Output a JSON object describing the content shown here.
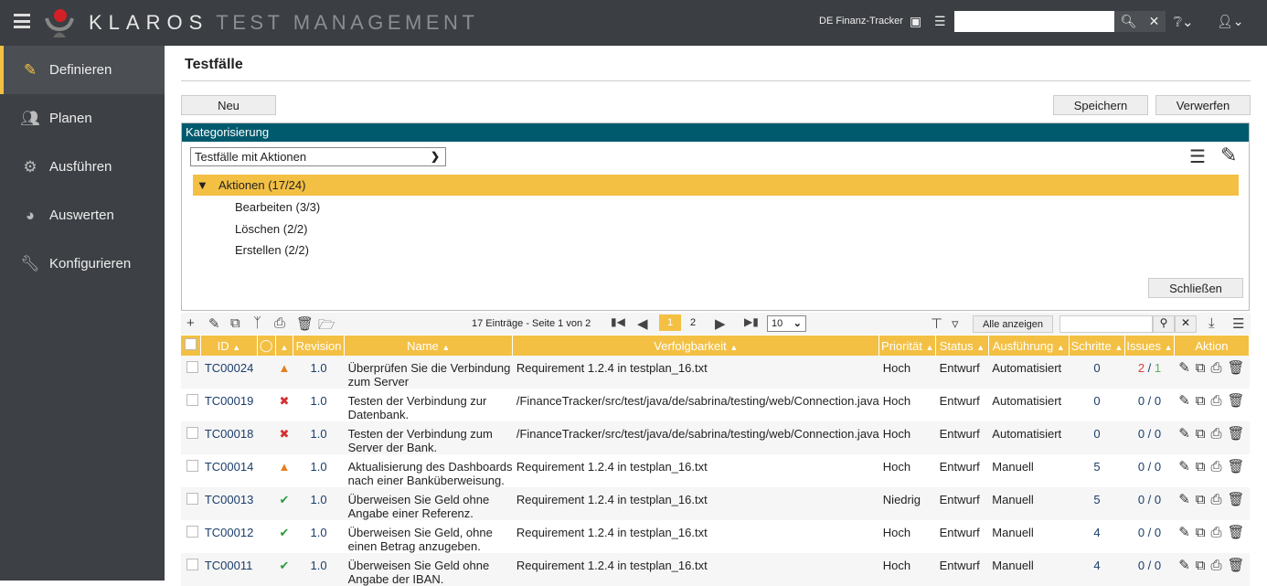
{
  "header": {
    "brand": "KLAROS",
    "brand_sub": "TEST MANAGEMENT",
    "project": "DE Finanz-Tracker",
    "search_value": ""
  },
  "sidebar": {
    "items": [
      {
        "label": "Definieren",
        "icon": "edit-icon",
        "active": true
      },
      {
        "label": "Planen",
        "icon": "users-icon"
      },
      {
        "label": "Ausführen",
        "icon": "gear-icon"
      },
      {
        "label": "Auswerten",
        "icon": "pie-chart-icon"
      },
      {
        "label": "Konfigurieren",
        "icon": "wrench-icon"
      }
    ]
  },
  "page": {
    "title": "Testfälle",
    "new": "Neu",
    "save": "Speichern",
    "discard": "Verwerfen"
  },
  "categorization": {
    "title": "Kategorisierung",
    "select": "Testfälle mit Aktionen",
    "root": "Aktionen (17/24)",
    "children": [
      "Bearbeiten (3/3)",
      "Löschen (2/2)",
      "Erstellen (2/2)"
    ],
    "close": "Schließen"
  },
  "toolbar": {
    "entries": "17 Einträge - Seite 1 von 2",
    "pages": [
      "1",
      "2"
    ],
    "current_page": "1",
    "page_size": "10",
    "show_all": "Alle anzeigen",
    "filter_value": ""
  },
  "table": {
    "headers": [
      "ID",
      "",
      "",
      "Revision",
      "Name",
      "Verfolgbarkeit",
      "Priorität",
      "Status",
      "Ausführung",
      "Schritte",
      "Issues",
      "Aktion"
    ],
    "rows": [
      {
        "id": "TC00024",
        "state": "warning",
        "revision": "1.0",
        "name": "Überprüfen Sie die Verbindung zum Server",
        "trace": "Requirement 1.2.4 in testplan_16.txt",
        "priority": "Hoch",
        "status": "Entwurf",
        "exec": "Automatisiert",
        "steps": "0",
        "issues_open": "2",
        "issues_closed": "1"
      },
      {
        "id": "TC00019",
        "state": "error",
        "revision": "1.0",
        "name": "Testen der Verbindung zur Datenbank.",
        "trace": "/FinanceTracker/src/test/java/de/sabrina/testing/web/Connection.java",
        "priority": "Hoch",
        "status": "Entwurf",
        "exec": "Automatisiert",
        "steps": "0",
        "issues_open": "0",
        "issues_closed": "0"
      },
      {
        "id": "TC00018",
        "state": "error",
        "revision": "1.0",
        "name": "Testen der Verbindung zum Server der Bank.",
        "trace": "/FinanceTracker/src/test/java/de/sabrina/testing/web/Connection.java",
        "priority": "Hoch",
        "status": "Entwurf",
        "exec": "Automatisiert",
        "steps": "0",
        "issues_open": "0",
        "issues_closed": "0"
      },
      {
        "id": "TC00014",
        "state": "warning",
        "revision": "1.0",
        "name": "Aktualisierung des Dashboards nach einer Banküberweisung.",
        "trace": "Requirement 1.2.4 in testplan_16.txt",
        "priority": "Hoch",
        "status": "Entwurf",
        "exec": "Manuell",
        "steps": "5",
        "issues_open": "0",
        "issues_closed": "0"
      },
      {
        "id": "TC00013",
        "state": "ok",
        "revision": "1.0",
        "name": "Überweisen Sie Geld ohne Angabe einer Referenz.",
        "trace": "Requirement 1.2.4 in testplan_16.txt",
        "priority": "Niedrig",
        "status": "Entwurf",
        "exec": "Manuell",
        "steps": "5",
        "issues_open": "0",
        "issues_closed": "0"
      },
      {
        "id": "TC00012",
        "state": "ok",
        "revision": "1.0",
        "name": "Überweisen Sie Geld, ohne einen Betrag anzugeben.",
        "trace": "Requirement 1.2.4 in testplan_16.txt",
        "priority": "Hoch",
        "status": "Entwurf",
        "exec": "Manuell",
        "steps": "4",
        "issues_open": "0",
        "issues_closed": "0"
      },
      {
        "id": "TC00011",
        "state": "ok",
        "revision": "1.0",
        "name": "Überweisen Sie Geld ohne Angabe der IBAN.",
        "trace": "Requirement 1.2.4 in testplan_16.txt",
        "priority": "Hoch",
        "status": "Entwurf",
        "exec": "Manuell",
        "steps": "4",
        "issues_open": "0",
        "issues_closed": "0"
      }
    ]
  },
  "colors": {
    "accent": "#f3c044",
    "topbar": "#3b3e42",
    "category_bar": "#005a6e",
    "link": "#1a3d6b",
    "issues_open": "#e53935",
    "issues_closed": "#5cae5c"
  }
}
